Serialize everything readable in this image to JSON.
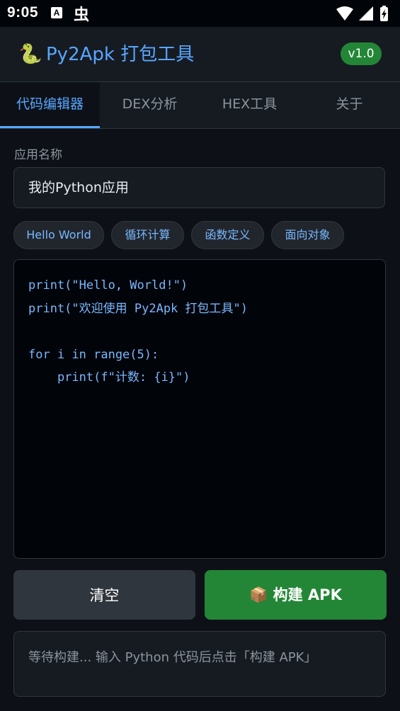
{
  "status_bar": {
    "time": "9:05",
    "notif_a": "A",
    "notif_b": "虫"
  },
  "header": {
    "logo_emoji": "🐍",
    "title": "Py2Apk 打包工具",
    "version": "v1.0"
  },
  "tabs": [
    {
      "label": "代码编辑器",
      "active": true
    },
    {
      "label": "DEX分析",
      "active": false
    },
    {
      "label": "HEX工具",
      "active": false
    },
    {
      "label": "关于",
      "active": false
    }
  ],
  "form": {
    "app_name_label": "应用名称",
    "app_name_value": "我的Python应用"
  },
  "templates": [
    {
      "label": "Hello World"
    },
    {
      "label": "循环计算"
    },
    {
      "label": "函数定义"
    },
    {
      "label": "面向对象"
    }
  ],
  "editor": {
    "lines": [
      "print(\"Hello, World!\")",
      "print(\"欢迎使用 Py2Apk 打包工具\")",
      "",
      "for i in range(5):",
      "    print(f\"计数: {i}\")"
    ]
  },
  "actions": {
    "clear_label": "清空",
    "build_icon": "📦",
    "build_label": "构建 APK"
  },
  "status_message": "等待构建... 输入 Python 代码后点击「构建 APK」",
  "colors": {
    "background": "#0d1117",
    "accent": "#58a6ff",
    "success": "#238636",
    "surface": "#161b22"
  }
}
